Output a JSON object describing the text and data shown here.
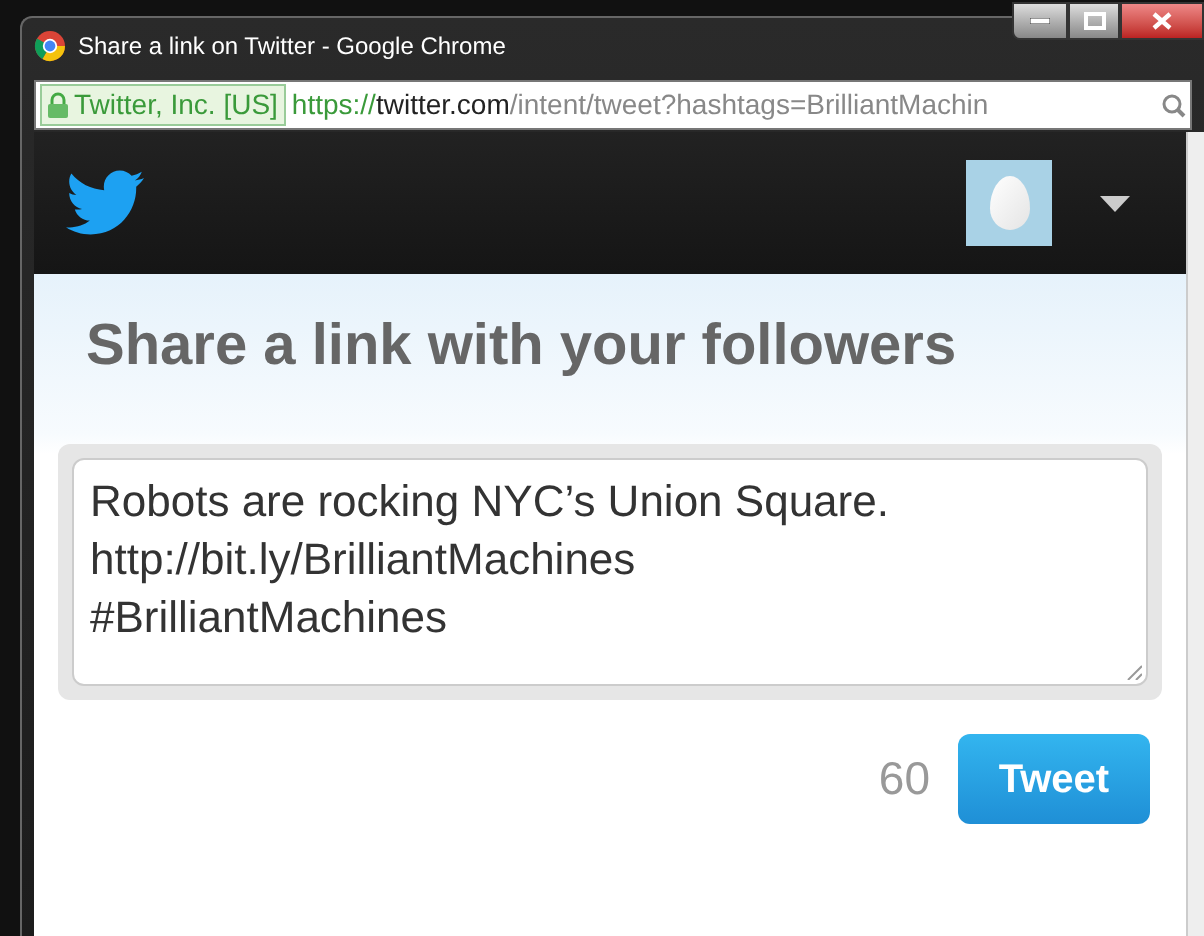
{
  "window": {
    "title": "Share a link on Twitter - Google Chrome"
  },
  "address_bar": {
    "certificate": "Twitter, Inc. [US]",
    "url_scheme": "https://",
    "url_host": "twitter.com",
    "url_path": "/intent/tweet?hashtags=BrilliantMachin"
  },
  "heading": "Share a link with your followers",
  "tweet_field": {
    "lines": [
      "Robots are rocking NYC’s Union Square.",
      "http://bit.ly/BrilliantMachines",
      "#BrilliantMachines"
    ]
  },
  "char_count": "60",
  "tweet_button": "Tweet"
}
